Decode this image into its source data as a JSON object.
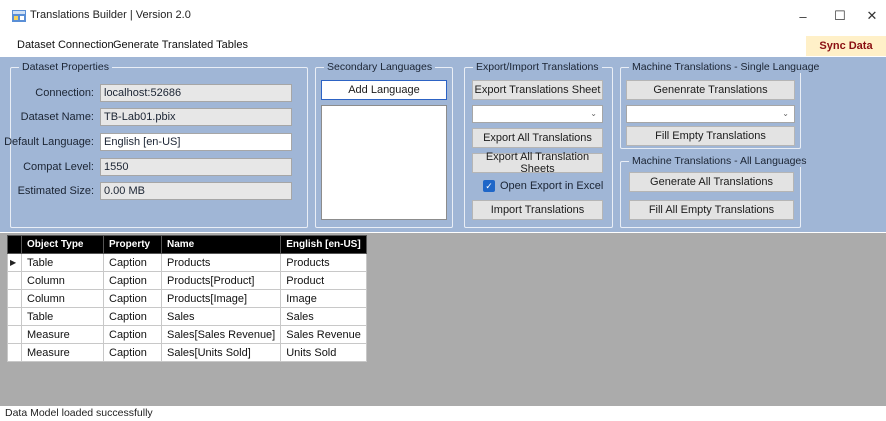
{
  "window": {
    "title": "Translations Builder | Version 2.0",
    "minimize_label": "–",
    "maximize_label": "☐",
    "close_label": "✕"
  },
  "menu": {
    "items": [
      "Dataset Connection",
      "Generate Translated Tables"
    ],
    "sync_label": "Sync Data Model"
  },
  "dataset_properties": {
    "title": "Dataset Properties",
    "connection_label": "Connection:",
    "connection_value": "localhost:52686",
    "dataset_name_label": "Dataset Name:",
    "dataset_name_value": "TB-Lab01.pbix",
    "default_language_label": "Default Language:",
    "default_language_value": "English [en-US]",
    "compat_level_label": "Compat Level:",
    "compat_level_value": "1550",
    "estimated_size_label": "Estimated Size:",
    "estimated_size_value": "0.00 MB"
  },
  "secondary_languages": {
    "title": "Secondary Languages",
    "add_button": "Add Language"
  },
  "export_import": {
    "title": "Export/Import Translations",
    "export_sheet_button": "Export Translations Sheet",
    "export_all_button": "Export All Translations",
    "export_all_sheets_button": "Export All Translation Sheets",
    "open_in_excel_label": "Open Export in Excel",
    "open_in_excel_checked": true,
    "import_button": "Import Translations"
  },
  "machine_single": {
    "title": "Machine Translations - Single Language",
    "generate_button": "Genenrate Translations",
    "fill_empty_button": "Fill Empty Translations"
  },
  "machine_all": {
    "title": "Machine Translations - All Languages",
    "generate_all_button": "Generate All Translations",
    "fill_all_empty_button": "Fill All Empty Translations"
  },
  "grid": {
    "columns": [
      "Object Type",
      "Property",
      "Name",
      "English [en-US]"
    ],
    "rows": [
      [
        "Table",
        "Caption",
        "Products",
        "Products"
      ],
      [
        "Column",
        "Caption",
        "Products[Product]",
        "Product"
      ],
      [
        "Column",
        "Caption",
        "Products[Image]",
        "Image"
      ],
      [
        "Table",
        "Caption",
        "Sales",
        "Sales"
      ],
      [
        "Measure",
        "Caption",
        "Sales[Sales Revenue]",
        "Sales Revenue"
      ],
      [
        "Measure",
        "Caption",
        "Sales[Units Sold]",
        "Units Sold"
      ]
    ],
    "current_row_marker": "▶"
  },
  "status": {
    "message": "Data Model loaded successfully"
  },
  "colors": {
    "panel": "#a0b6d6",
    "sync_text": "#8a0f12",
    "sync_bg": "#fff0c8",
    "grid_header": "#000000",
    "grid_area": "#ababab"
  }
}
